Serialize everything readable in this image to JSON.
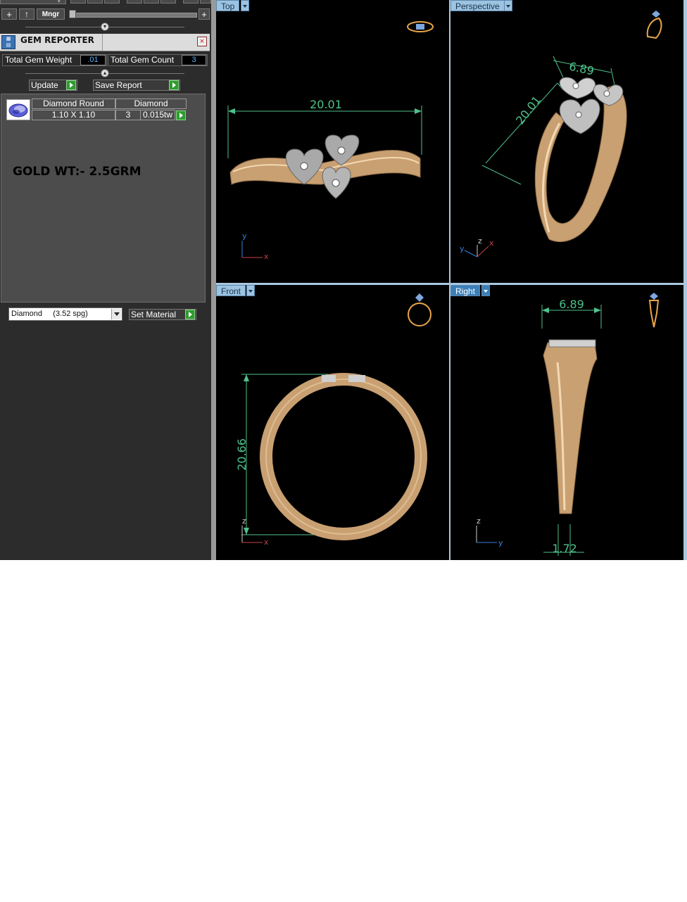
{
  "toolbar": {
    "row2": {
      "add_label": "+",
      "up_label": "↑",
      "manager_label": "Mngr",
      "plus_right_label": "+"
    }
  },
  "gem_reporter": {
    "title": "GEM REPORTER",
    "total_gem_weight_label": "Total Gem Weight",
    "total_gem_weight_value": ".01",
    "total_gem_count_label": "Total Gem Count",
    "total_gem_count_value": "3",
    "update_label": "Update",
    "save_report_label": "Save Report",
    "table": {
      "headers": [
        "Diamond Round",
        "Diamond"
      ],
      "row": {
        "size": "1.10 X 1.10",
        "count": "3",
        "weight": "0.015tw"
      }
    },
    "note": "GOLD WT:- 2.5GRM",
    "material_select": "Diamond     (3.52 spg)",
    "set_material_label": "Set Material"
  },
  "viewports": {
    "top": {
      "label": "Top",
      "dimension": "20.01",
      "axis_a": "y",
      "axis_b": "x"
    },
    "perspective": {
      "label": "Perspective",
      "dimension_a": "6.89",
      "dimension_b": "20.01",
      "axis_y": "y",
      "axis_z": "z",
      "axis_x": "x"
    },
    "front": {
      "label": "Front",
      "dimension": "20.66",
      "axis_a": "z",
      "axis_b": "x"
    },
    "right": {
      "label": "Right",
      "dimension_top": "6.89",
      "dimension_bottom": "1.72",
      "axis_a": "z",
      "axis_b": "y"
    }
  },
  "colors": {
    "viewport_bg": "#000000",
    "dimension_green": "#4fc18b",
    "gold": "#c9a072",
    "active_tab": "#3b7fb8"
  }
}
